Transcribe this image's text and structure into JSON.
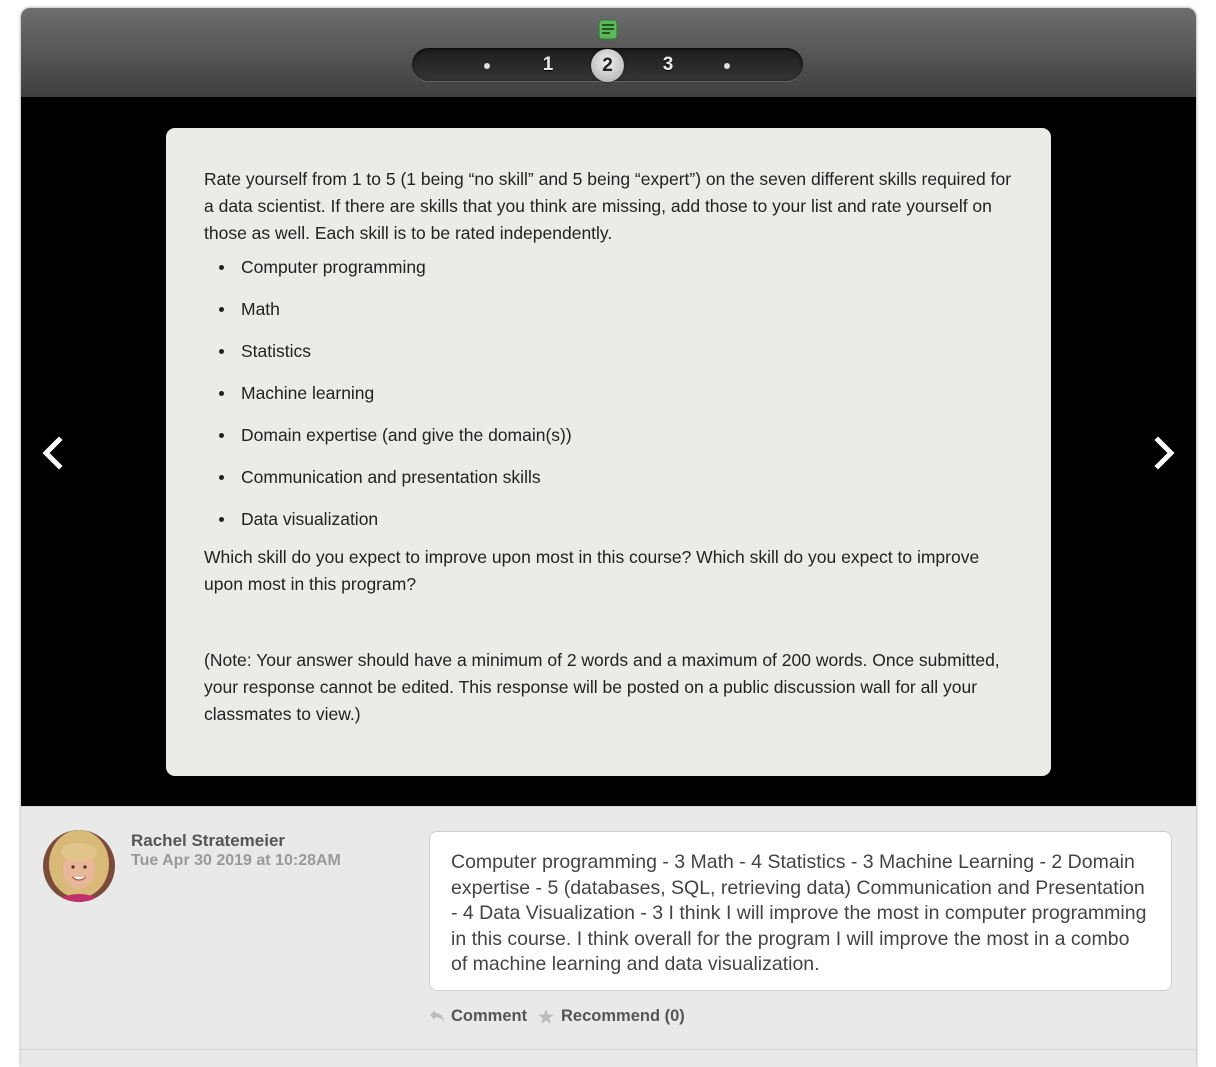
{
  "pager": {
    "pages": [
      "1",
      "2",
      "3"
    ],
    "active": "2"
  },
  "prompt": {
    "intro": "Rate yourself from 1 to 5 (1 being “no skill” and 5 being “expert”) on the seven different skills required for a data scientist. If there are skills that you think are missing, add those to your list and rate yourself on those as well. Each skill is to be rated independently.",
    "skills": [
      "Computer programming",
      "Math",
      "Statistics",
      "Machine learning",
      "Domain expertise (and give the domain(s))",
      "Communication and presentation skills",
      "Data visualization"
    ],
    "question": "Which skill do you expect to improve upon most in this course? Which skill do you expect to improve upon most in this program?",
    "note": "(Note: Your answer should have a minimum of 2 words and a maximum of 200 words. Once submitted, your response cannot be edited. This response will be posted on a public discussion wall for all your classmates to view.)"
  },
  "response": {
    "author": "Rachel Stratemeier",
    "timestamp": "Tue Apr 30 2019 at 10:28AM",
    "text": "Computer programming - 3 Math - 4 Statistics - 3 Machine Learning - 2 Domain expertise - 5 (databases, SQL, retrieving data) Communication and Presentation - 4 Data Visualization - 3 I think I will improve the most in computer programming in this course. I think overall for the program I will improve the most in a combo of machine learning and data visualization.",
    "comment_label": "Comment",
    "recommend_label": "Recommend (0)"
  },
  "icons": {
    "document": "document-icon",
    "prev": "chevron-left-icon",
    "next": "chevron-right-icon",
    "comment": "reply-arrow-icon",
    "recommend": "star-icon"
  },
  "colors": {
    "icon_green": "#5fb65a",
    "card_background": "#ebebe7"
  }
}
